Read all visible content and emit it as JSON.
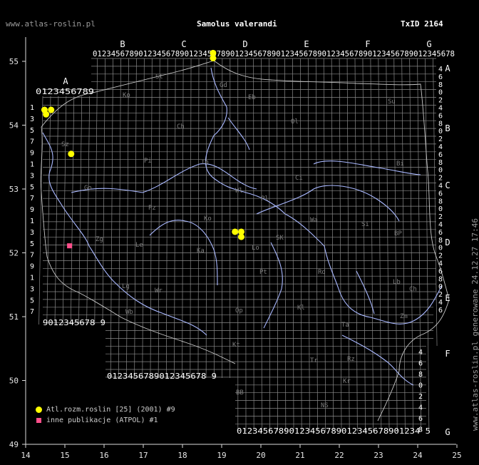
{
  "header": {
    "site": "www.atlas-roslin.pl",
    "species": "Samolus valerandi",
    "txid": "TxID 2164"
  },
  "footer": {
    "generated": "www.atlas-roslin.pl generowane 24.12.27 17:46"
  },
  "axes": {
    "x_ticks": [
      "14",
      "15",
      "16",
      "17",
      "18",
      "19",
      "20",
      "21",
      "22",
      "23",
      "24",
      "25"
    ],
    "y_ticks": [
      "49",
      "50",
      "51",
      "52",
      "53",
      "54",
      "55"
    ]
  },
  "grid": {
    "top_columns": [
      "B",
      "C",
      "D",
      "E",
      "F",
      "G"
    ],
    "top_west_column": "A",
    "top_digits_row1": "0123456789012345678901234567890123456789012345678901234567890123456789012345678",
    "top_digits_row_A": "0123456789",
    "bottom_digits_left": "9012345678 9",
    "bottom_digits_mid": "0123456789012345678 9",
    "bottom_digits_right": "01234567890123456789012345678901234 5",
    "right_rows": [
      "A",
      "B",
      "C",
      "D",
      "E",
      "F",
      "G"
    ],
    "left_rows_digits": [
      "1",
      "3",
      "5",
      "7",
      "9",
      "1",
      "3",
      "5",
      "7",
      "9",
      "1",
      "3",
      "5",
      "7",
      "9",
      "1",
      "3",
      "5",
      "7",
      "9"
    ],
    "region_labels": [
      "St",
      "Ko",
      "Gd",
      "Eb",
      "Su",
      "Ch",
      "Ol",
      "Sz",
      "Pi",
      "To",
      "Ci",
      "Bi",
      "Go",
      "Pz",
      "Wl",
      "Pl",
      "Ko",
      "Wa",
      "Si",
      "BP",
      "Zg",
      "Le",
      "Ka",
      "SK",
      "Lo",
      "Lg",
      "Wr",
      "Pt",
      "Rd",
      "Lb",
      "Ch",
      "Wb",
      "Op",
      "Kl",
      "Kt",
      "Ta",
      "Zm",
      "Tr",
      "Rz",
      "Kr",
      "BB",
      "NS"
    ]
  },
  "legend": [
    {
      "symbol": "dot",
      "label": "Atl.rozm.roslin [25] (2001) #9",
      "color": "#ffff00"
    },
    {
      "symbol": "square",
      "label": "inne publikacje (ATPOL) #1",
      "color": "#ff4f8b"
    }
  ],
  "records": {
    "atlas": [
      {
        "lon": 14.48,
        "lat": 54.24
      },
      {
        "lon": 14.65,
        "lat": 54.24
      },
      {
        "lon": 14.52,
        "lat": 54.17
      },
      {
        "lon": 15.16,
        "lat": 53.55
      },
      {
        "lon": 18.78,
        "lat": 55.13
      },
      {
        "lon": 18.78,
        "lat": 55.05
      },
      {
        "lon": 19.34,
        "lat": 52.33
      },
      {
        "lon": 19.5,
        "lat": 52.33
      },
      {
        "lon": 19.5,
        "lat": 52.25
      }
    ],
    "other": [
      {
        "lon": 15.12,
        "lat": 52.11
      }
    ]
  }
}
